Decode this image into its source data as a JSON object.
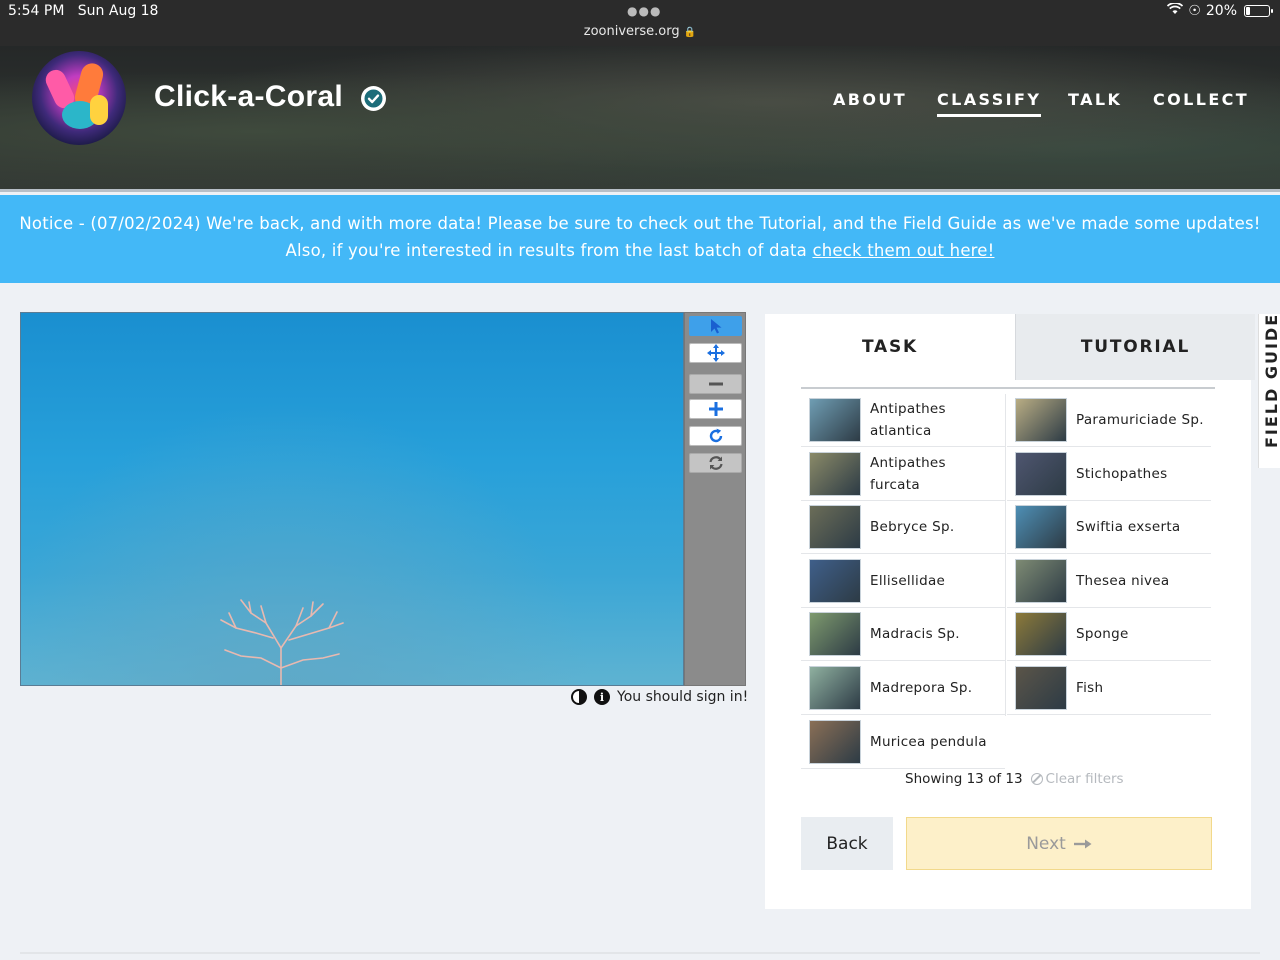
{
  "status_bar": {
    "time": "5:54 PM",
    "date": "Sun Aug 18",
    "url": "zooniverse.org",
    "battery": "20%",
    "battery_level": 0.2
  },
  "header": {
    "project_title": "Click-a-Coral",
    "nav": [
      "ABOUT",
      "CLASSIFY",
      "TALK",
      "COLLECT"
    ],
    "active_nav": "CLASSIFY"
  },
  "notice": {
    "text": "Notice - (07/02/2024) We're back, and with more data! Please be sure to check out the Tutorial, and the Field Guide as we've made some updates! Also, if you're interested in results from the last batch of data",
    "link_text": "check them out here!"
  },
  "viewer": {
    "footer_text": "You should sign in!",
    "info_glyph": "i"
  },
  "task_panel": {
    "tabs": [
      "TASK",
      "TUTORIAL"
    ],
    "choices_left": [
      {
        "line1": "Antipathes",
        "line2": "atlantica",
        "thumb_color": "#6f9db3"
      },
      {
        "line1": "Antipathes",
        "line2": "furcata",
        "thumb_color": "#8a8a68"
      },
      {
        "line1": "Bebryce Sp.",
        "line2": "",
        "thumb_color": "#6b6d58"
      },
      {
        "line1": "Ellisellidae",
        "line2": "",
        "thumb_color": "#3f5f8a"
      },
      {
        "line1": "Madracis Sp.",
        "line2": "",
        "thumb_color": "#7e9a6e"
      },
      {
        "line1": "Madrepora Sp.",
        "line2": "",
        "thumb_color": "#8fb0a0"
      },
      {
        "line1": "Muricea pendula",
        "line2": "",
        "thumb_color": "#8a6f56"
      }
    ],
    "choices_right": [
      {
        "line1": "Paramuriciade Sp.",
        "line2": "",
        "thumb_color": "#b9ad84"
      },
      {
        "line1": "Stichopathes",
        "line2": "",
        "thumb_color": "#4f5670"
      },
      {
        "line1": "Swiftia exserta",
        "line2": "",
        "thumb_color": "#4e8fb5"
      },
      {
        "line1": "Thesea nivea",
        "line2": "",
        "thumb_color": "#7e8b74"
      },
      {
        "line1": "Sponge",
        "line2": "",
        "thumb_color": "#8c7a3a"
      },
      {
        "line1": "Fish",
        "line2": "",
        "thumb_color": "#5b5549"
      }
    ],
    "showing": "Showing 13 of 13",
    "clear_filters": "Clear filters",
    "back_label": "Back",
    "next_label": "Next"
  },
  "field_guide": {
    "label": "FIELD GUIDE"
  },
  "colors": {
    "notice_bg": "#43b8f7",
    "accent_blue": "#3ea0ea",
    "next_bg": "#fdf0c9"
  }
}
